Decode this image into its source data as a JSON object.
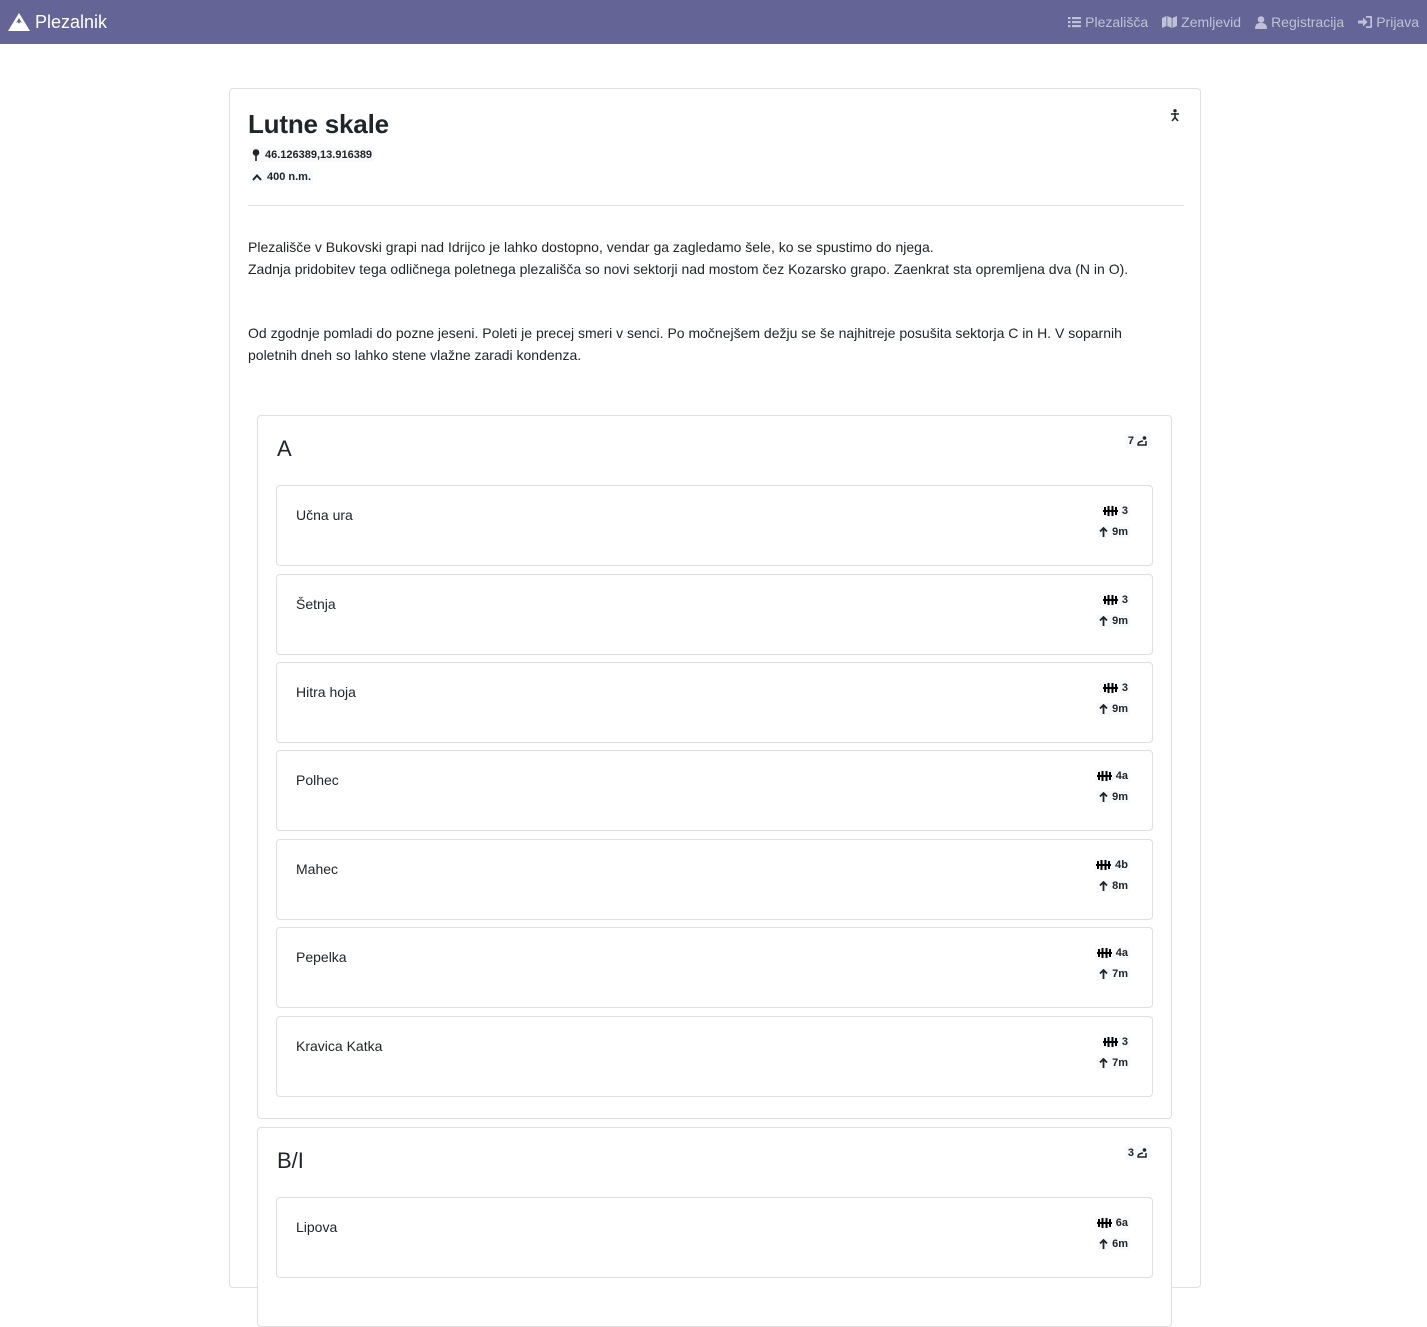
{
  "navbar": {
    "brand": "Plezalnik",
    "links": [
      {
        "label": "Plezališča",
        "icon": "list-icon"
      },
      {
        "label": "Zemljevid",
        "icon": "map-icon"
      },
      {
        "label": "Registracija",
        "icon": "user-icon"
      },
      {
        "label": "Prijava",
        "icon": "sign-in-icon"
      }
    ]
  },
  "crag": {
    "title": "Lutne skale",
    "coordinates": "46.126389,13.916389",
    "altitude": "400 n.m.",
    "description_lines": [
      "Plezališče v Bukovski grapi nad Idrijco je lahko dostopno, vendar ga zagledamo šele, ko se spustimo do njega.",
      "Zadnja pridobitev tega odličnega poletnega plezališča so novi sektorji nad mostom čez Kozarsko grapo. Zaenkrat sta opremljena dva (N in O)."
    ],
    "conditions": "Od zgodnje pomladi do pozne jeseni. Poleti je precej smeri v senci. Po močnejšem dežju se še najhitreje posušita sektorja C in H. V soparnih poletnih dneh so lahko stene vlažne zaradi kondenza."
  },
  "sectors": [
    {
      "name": "A",
      "route_count": "7",
      "routes": [
        {
          "name": "Učna ura",
          "grade": "3",
          "length": "9m"
        },
        {
          "name": "Šetnja",
          "grade": "3",
          "length": "9m"
        },
        {
          "name": "Hitra hoja",
          "grade": "3",
          "length": "9m"
        },
        {
          "name": "Polhec",
          "grade": "4a",
          "length": "9m"
        },
        {
          "name": "Mahec",
          "grade": "4b",
          "length": "8m"
        },
        {
          "name": "Pepelka",
          "grade": "4a",
          "length": "7m"
        },
        {
          "name": "Kravica Katka",
          "grade": "3",
          "length": "7m"
        }
      ]
    },
    {
      "name": "B/I",
      "route_count": "3",
      "routes": [
        {
          "name": "Lipova",
          "grade": "6a",
          "length": "6m"
        }
      ]
    }
  ]
}
